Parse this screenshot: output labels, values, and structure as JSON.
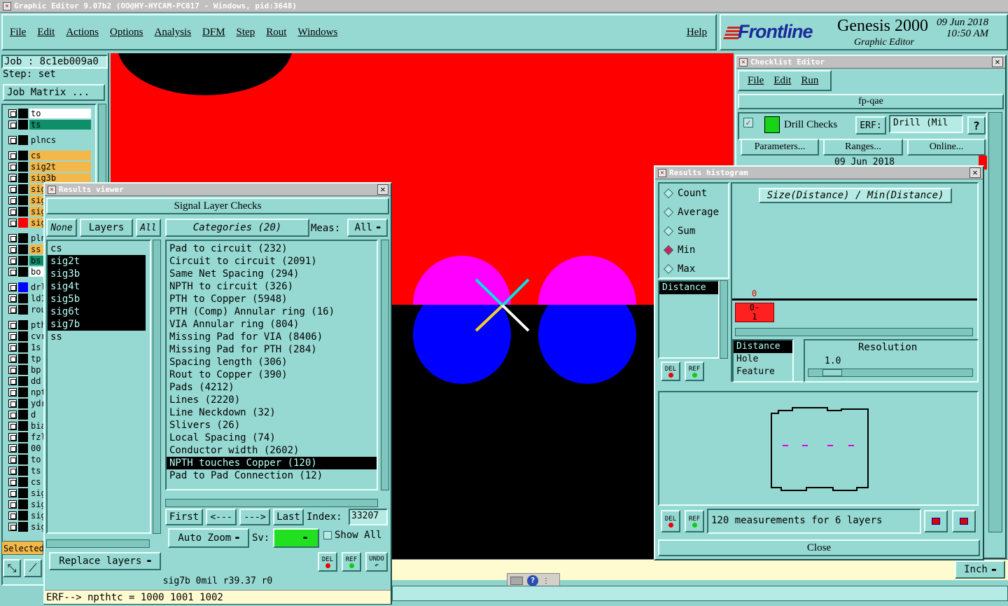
{
  "window_title": "Graphic Editor 9.07b2 (OO@HY-HYCAM-PC017 - Windows, pid:3648)",
  "menu": [
    "File",
    "Edit",
    "Actions",
    "Options",
    "Analysis",
    "DFM",
    "Step",
    "Rout",
    "Windows"
  ],
  "help_label": "Help",
  "brand": {
    "logo": "Frontline",
    "product": "Genesis 2000",
    "subtitle": "Graphic Editor",
    "date": "09 Jun 2018",
    "time": "10:50 AM"
  },
  "job": {
    "job_label": "Job : 8c1eb009a0",
    "step_label": "Step: set",
    "matrix_button": "Job Matrix ..."
  },
  "layers": [
    {
      "name": "to",
      "bg": "#ffffff",
      "color": "#000000"
    },
    {
      "name": "ts",
      "bg": "#0e8f6a",
      "color": "#000000"
    },
    {
      "name": "plncs",
      "bg": "#96d9d2",
      "color": "#000000"
    },
    {
      "name": "cs",
      "bg": "#f4b84a",
      "color": "#000000"
    },
    {
      "name": "sig2t",
      "bg": "#f4b84a",
      "color": "#000000"
    },
    {
      "name": "sig3b",
      "bg": "#f4b84a",
      "color": "#000000"
    },
    {
      "name": "sig4t",
      "bg": "#f4b84a",
      "color": "#000000"
    },
    {
      "name": "sig5b",
      "bg": "#f4b84a",
      "color": "#000000"
    },
    {
      "name": "sig6t",
      "bg": "#f4b84a",
      "color": "#000000"
    },
    {
      "name": "sig7b",
      "bg": "#f4b84a",
      "color": "#ff0000"
    },
    {
      "name": "plnss",
      "bg": "#96d9d2",
      "color": "#000000"
    },
    {
      "name": "ss",
      "bg": "#f4b84a",
      "color": "#000000"
    },
    {
      "name": "bs",
      "bg": "#0e8f6a",
      "color": "#000000"
    },
    {
      "name": "bo",
      "bg": "#ffffff",
      "color": "#000000"
    },
    {
      "name": "drl",
      "bg": "#96d9d2",
      "color": "#0000ff"
    },
    {
      "name": "ld1",
      "bg": "#96d9d2",
      "color": "#000000"
    },
    {
      "name": "rout",
      "bg": "#96d9d2",
      "color": "#000000"
    },
    {
      "name": "pth",
      "bg": "#96d9d2",
      "color": "#000000"
    },
    {
      "name": "cvr",
      "bg": "#96d9d2",
      "color": "#000000"
    },
    {
      "name": "1s",
      "bg": "#96d9d2",
      "color": "#000000"
    },
    {
      "name": "tp",
      "bg": "#96d9d2",
      "color": "#000000"
    },
    {
      "name": "bp",
      "bg": "#96d9d2",
      "color": "#000000"
    },
    {
      "name": "dd",
      "bg": "#96d9d2",
      "color": "#000000"
    },
    {
      "name": "npth",
      "bg": "#96d9d2",
      "color": "#000000"
    },
    {
      "name": "ydr",
      "bg": "#96d9d2",
      "color": "#000000"
    },
    {
      "name": "d",
      "bg": "#96d9d2",
      "color": "#000000"
    },
    {
      "name": "bia",
      "bg": "#96d9d2",
      "color": "#000000"
    },
    {
      "name": "fzl",
      "bg": "#96d9d2",
      "color": "#000000"
    },
    {
      "name": "00",
      "bg": "#96d9d2",
      "color": "#000000"
    },
    {
      "name": "to",
      "bg": "#96d9d2",
      "color": "#000000"
    },
    {
      "name": "ts",
      "bg": "#96d9d2",
      "color": "#000000"
    },
    {
      "name": "cs",
      "bg": "#96d9d2",
      "color": "#000000"
    },
    {
      "name": "sig",
      "bg": "#96d9d2",
      "color": "#000000"
    },
    {
      "name": "sig",
      "bg": "#96d9d2",
      "color": "#000000"
    },
    {
      "name": "sig",
      "bg": "#96d9d2",
      "color": "#000000"
    },
    {
      "name": "sig",
      "bg": "#96d9d2",
      "color": "#000000"
    }
  ],
  "selected_label": "Selected",
  "results_viewer": {
    "title": "Results viewer",
    "heading": "Signal Layer Checks",
    "none_label": "None",
    "layers_label": "Layers",
    "all_label": "All",
    "layer_list": [
      "cs",
      "sig2t",
      "sig3b",
      "sig4t",
      "sig5b",
      "sig6t",
      "sig7b",
      "ss"
    ],
    "categories_label": "Categories (20)",
    "meas_label": "Meas:",
    "meas_value": "All",
    "categories": [
      "Pad to circuit (232)",
      "Circuit to circuit (2091)",
      "Same Net Spacing (294)",
      "NPTH to circuit (326)",
      "PTH to Copper (5948)",
      "PTH (Comp) Annular ring (16)",
      "VIA Annular ring (804)",
      "Missing Pad for VIA (8406)",
      "Missing Pad for PTH (284)",
      "Spacing length (306)",
      "Rout to Copper (390)",
      "Pads (4212)",
      "Lines (2220)",
      "Line Neckdown (32)",
      "Slivers (26)",
      "Local Spacing (74)",
      "Conductor width (2602)",
      "NPTH touches Copper (120)",
      "Pad to Pad Connection (12)"
    ],
    "first_label": "First",
    "prev_label": "<---",
    "next_label": "--->",
    "last_label": "Last",
    "index_label": "Index:",
    "index_value": "33207",
    "auto_zoom_label": "Auto Zoom",
    "sv_label": "Sv:",
    "show_all_label": "Show All",
    "replace_label": "Replace layers",
    "del_label": "DEL",
    "ref_label": "REF",
    "undo_label": "UNDO",
    "status": "sig7b 0mil  r39.37  r0",
    "erf_line": "ERF--> npthtc = 1000 1001 1002"
  },
  "checklist": {
    "title": "Checklist Editor",
    "menu": [
      "File",
      "Edit",
      "Run"
    ],
    "name": "fp-qae",
    "drill_checks_label": "Drill Checks",
    "erf_label": "ERF:",
    "erf_value": "Drill (Mil",
    "help_btn": "?",
    "params_label": "Parameters...",
    "ranges_label": "Ranges...",
    "online_label": "Online...",
    "date_text": "09 Jun 2018"
  },
  "histogram": {
    "title": "Results histogram",
    "modes": [
      {
        "label": "Count",
        "on": false
      },
      {
        "label": "Average",
        "on": false
      },
      {
        "label": "Sum",
        "on": false
      },
      {
        "label": "Min",
        "on": true
      },
      {
        "label": "Max",
        "on": false
      }
    ],
    "attr_list": [
      "Distance"
    ],
    "plot_title": "Size(Distance) / Min(Distance)",
    "bar_top_label": "0",
    "bar_label": "0-\n1",
    "feature_list": [
      "Distance",
      "Hole",
      "Feature"
    ],
    "resolution_label": "Resolution",
    "resolution_value": "1.0",
    "del_label": "DEL",
    "ref_label": "REF",
    "summary": "120 measurements for 6 layers",
    "close_label": "Close"
  },
  "units_label": "Inch",
  "colors": {
    "canvas_red": "#ff0000",
    "canvas_black": "#000000",
    "pad_blue": "#0000ff",
    "pad_magenta": "#ff00ff",
    "teal_ui": "#96d9d2"
  }
}
